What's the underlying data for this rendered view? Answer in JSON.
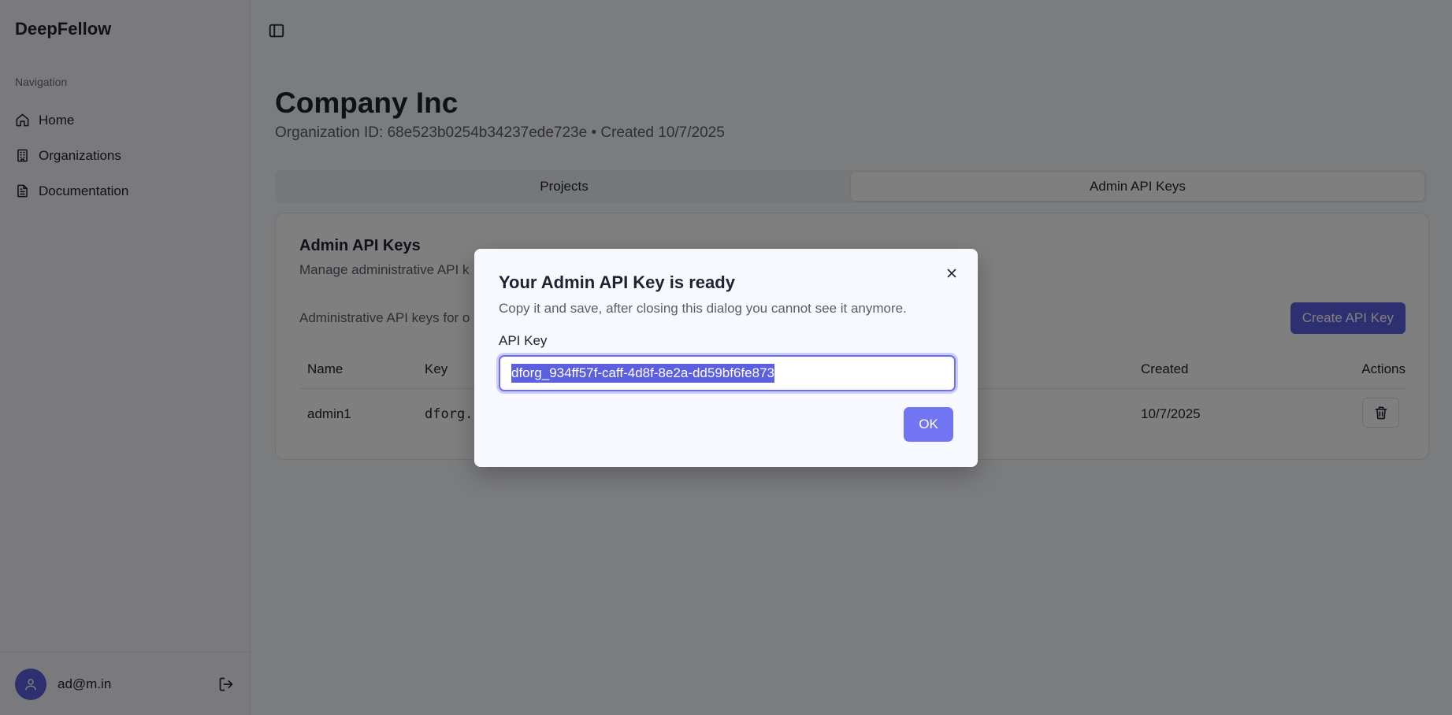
{
  "app": {
    "brand": "DeepFellow"
  },
  "sidebar": {
    "section_label": "Navigation",
    "items": [
      {
        "label": "Home",
        "icon": "home-icon"
      },
      {
        "label": "Organizations",
        "icon": "building-icon"
      },
      {
        "label": "Documentation",
        "icon": "document-icon"
      }
    ],
    "user": {
      "email": "ad@m.in"
    }
  },
  "header": {
    "title": "Company Inc",
    "subtitle": "Organization ID: 68e523b0254b34237ede723e • Created 10/7/2025"
  },
  "tabs": [
    {
      "label": "Projects",
      "active": false
    },
    {
      "label": "Admin API Keys",
      "active": true
    }
  ],
  "card": {
    "title": "Admin API Keys",
    "description": "Manage administrative API k",
    "note": "Administrative API keys for o",
    "create_label": "Create API Key",
    "columns": {
      "name": "Name",
      "key": "Key",
      "created": "Created",
      "actions": "Actions"
    },
    "rows": [
      {
        "name": "admin1",
        "key": "dforg.",
        "created": "10/7/2025"
      }
    ]
  },
  "dialog": {
    "title": "Your Admin API Key is ready",
    "description": "Copy it and save, after closing this dialog you cannot see it anymore.",
    "field_label": "API Key",
    "api_key": "dforg_934ff57f-caff-4d8f-8e2a-dd59bf6fe873",
    "ok_label": "OK"
  },
  "colors": {
    "accent": "#5b5fe0",
    "ok_button": "#7275f2",
    "overlay": "rgba(0,0,0,0.5)"
  }
}
